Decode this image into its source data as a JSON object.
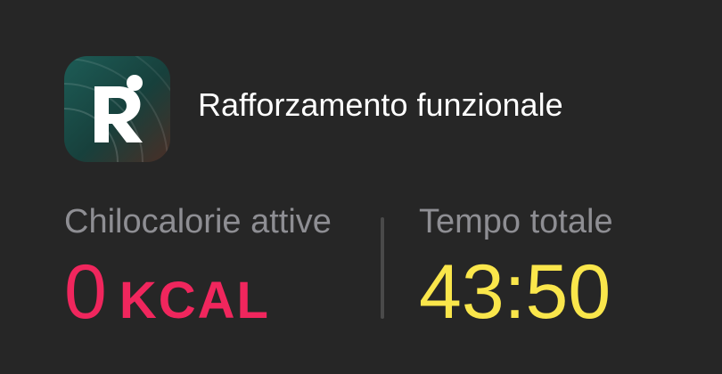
{
  "workout": {
    "app_icon": "strength-app-icon",
    "title": "Rafforzamento funzionale"
  },
  "metrics": {
    "active_calories": {
      "label": "Chilocalorie attive",
      "value": "0",
      "unit": "KCAL",
      "color": "#f0265d"
    },
    "total_time": {
      "label": "Tempo totale",
      "value": "43:50",
      "color": "#fae64b"
    }
  },
  "colors": {
    "background": "#262626",
    "label": "#8e8e93",
    "title": "#ffffff"
  }
}
